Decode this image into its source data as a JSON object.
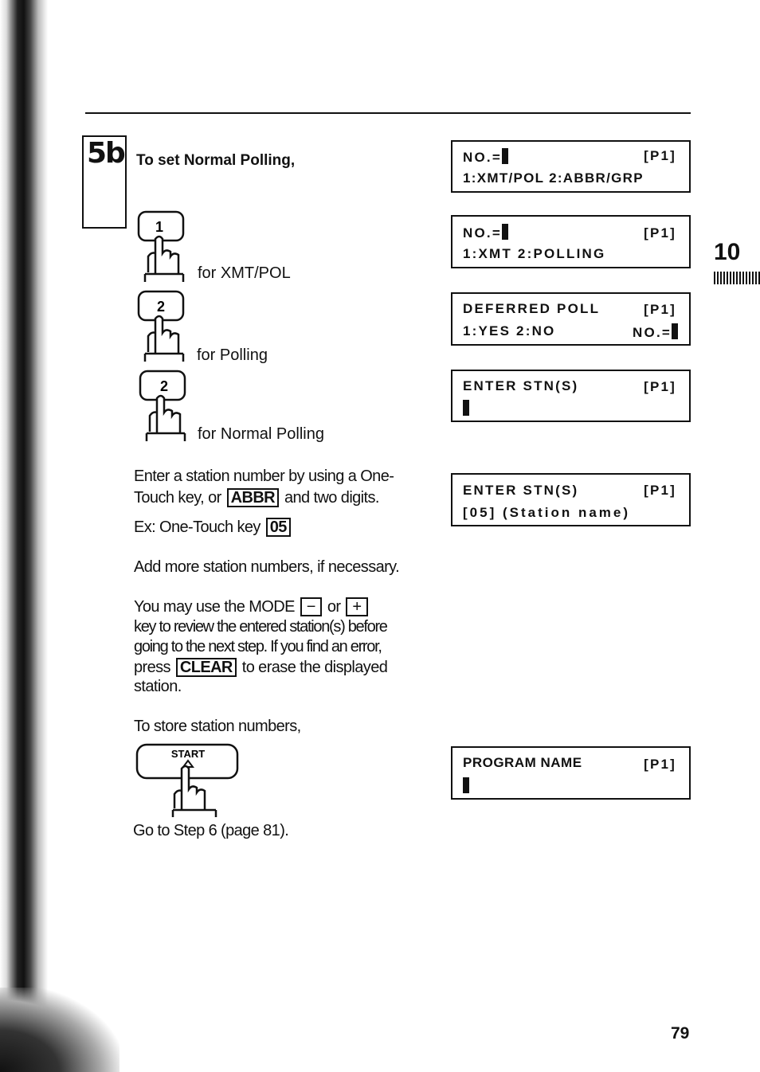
{
  "step": {
    "number": "5b",
    "heading": "To set Normal Polling,"
  },
  "keys": [
    {
      "key": "1",
      "label": "for XMT/POL"
    },
    {
      "key": "2",
      "label": "for Polling"
    },
    {
      "key": "2",
      "label": "for Normal Polling"
    }
  ],
  "instructions": {
    "enter_line1": "Enter a station number by using a One-",
    "enter_line2a": "Touch key, or",
    "abbr_key": "ABBR",
    "enter_line2b": "and two digits.",
    "example_prefix": "Ex: One-Touch key",
    "example_key": "05",
    "add_more": "Add more station numbers, if necessary.",
    "review_a": "You may use the MODE",
    "minus_key": "−",
    "review_or": "or",
    "plus_key": "+",
    "review_line2": "key to review the entered station(s) before",
    "review_line3": "going to the next step. If you find an error,",
    "review_press": "press",
    "clear_key": "CLEAR",
    "review_line4b": "to erase the displayed",
    "review_line5": "station.",
    "store": "To store station numbers,",
    "start_key": "START",
    "goto": "Go to Step 6 (page 81)."
  },
  "displays": [
    {
      "line1": "NO.=",
      "line1_right": "[P1]",
      "line2": "1:XMT/POL  2:ABBR/GRP"
    },
    {
      "line1": "NO.=",
      "line1_right": "[P1]",
      "line2": "1:XMT  2:POLLING"
    },
    {
      "line1": "DEFERRED  POLL",
      "line1_right": "[P1]",
      "line2": "1:YES  2:NO",
      "line2_right": "NO.="
    },
    {
      "line1": "ENTER  STN(S)",
      "line1_right": "[P1]"
    },
    {
      "line1": "ENTER  STN(S)",
      "line1_right": "[P1]",
      "line2": "[05]  (Station  name)"
    },
    {
      "line1": "PROGRAM  NAME",
      "line1_right": "[P1]"
    }
  ],
  "section_tab": "10",
  "page_number": "79"
}
